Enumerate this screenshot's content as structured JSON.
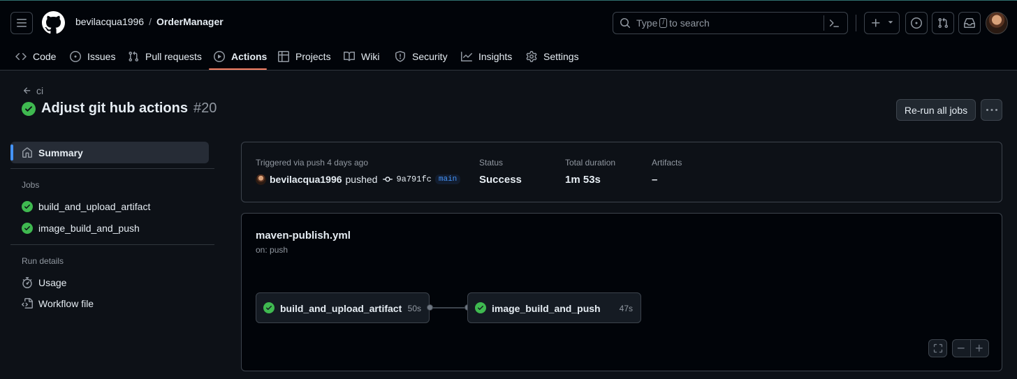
{
  "header": {
    "owner": "bevilacqua1996",
    "separator": "/",
    "repo": "OrderManager",
    "search_prefix": "Type",
    "search_key": "/",
    "search_suffix": "to search"
  },
  "repo_tabs": [
    {
      "label": "Code",
      "icon": "code-icon"
    },
    {
      "label": "Issues",
      "icon": "issue-opened-icon"
    },
    {
      "label": "Pull requests",
      "icon": "git-pull-request-icon"
    },
    {
      "label": "Actions",
      "icon": "play-icon",
      "active": true
    },
    {
      "label": "Projects",
      "icon": "table-icon"
    },
    {
      "label": "Wiki",
      "icon": "book-icon"
    },
    {
      "label": "Security",
      "icon": "shield-icon"
    },
    {
      "label": "Insights",
      "icon": "graph-icon"
    },
    {
      "label": "Settings",
      "icon": "gear-icon"
    }
  ],
  "run": {
    "back_label": "ci",
    "title": "Adjust git hub actions",
    "number": "#20",
    "rerun_label": "Re-run all jobs"
  },
  "sidebar": {
    "summary_label": "Summary",
    "jobs_heading": "Jobs",
    "jobs": [
      "build_and_upload_artifact",
      "image_build_and_push"
    ],
    "details_heading": "Run details",
    "usage_label": "Usage",
    "workflow_file_label": "Workflow file"
  },
  "summary": {
    "trigger_label": "Triggered via push 4 days ago",
    "user": "bevilacqua1996",
    "action": "pushed",
    "sha": "9a791fc",
    "branch": "main",
    "status_label": "Status",
    "status_value": "Success",
    "duration_label": "Total duration",
    "duration_value": "1m 53s",
    "artifacts_label": "Artifacts",
    "artifacts_value": "–"
  },
  "workflow": {
    "file": "maven-publish.yml",
    "trigger": "on: push",
    "jobs": [
      {
        "name": "build_and_upload_artifact",
        "duration": "50s"
      },
      {
        "name": "image_build_and_push",
        "duration": "47s"
      }
    ]
  },
  "colors": {
    "success": "#3fb950",
    "accent": "#4493f8",
    "tab_underline": "#f78166"
  }
}
